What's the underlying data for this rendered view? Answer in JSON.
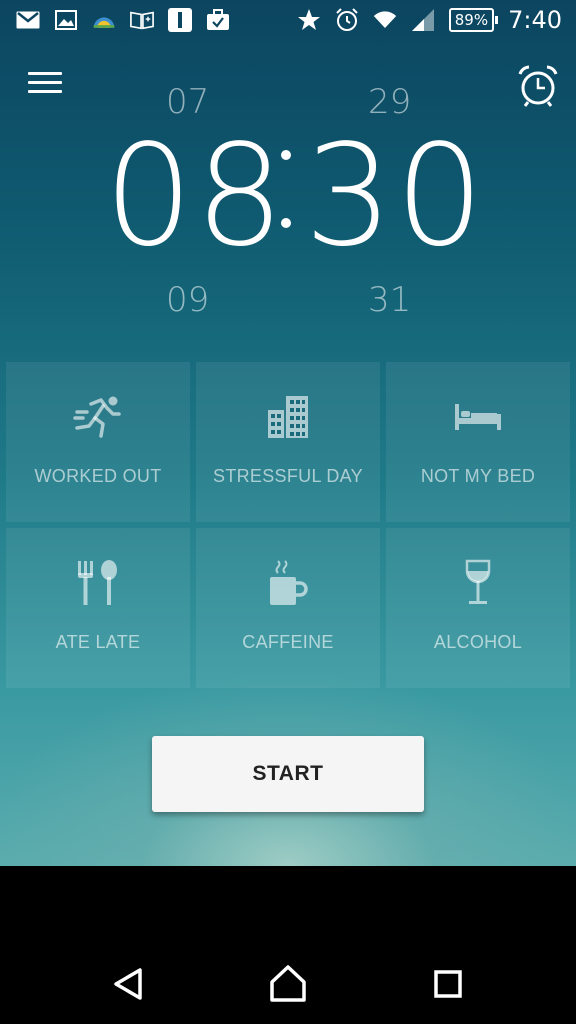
{
  "status_bar": {
    "battery": "89%",
    "time": "7:40"
  },
  "clock": {
    "hour_prev": "07",
    "minute_prev": "29",
    "hour": "08",
    "minute": "30",
    "hour_next": "09",
    "minute_next": "31"
  },
  "factors": [
    {
      "label": "WORKED OUT",
      "icon": "running-person-icon"
    },
    {
      "label": "STRESSFUL DAY",
      "icon": "office-building-icon"
    },
    {
      "label": "NOT MY BED",
      "icon": "bed-icon"
    },
    {
      "label": "ATE LATE",
      "icon": "fork-spoon-icon"
    },
    {
      "label": "CAFFEINE",
      "icon": "coffee-cup-icon"
    },
    {
      "label": "ALCOHOL",
      "icon": "wine-glass-icon"
    }
  ],
  "start_label": "START",
  "colors": {
    "accent": "#ffffff",
    "background_top": "#0c4560",
    "background_bottom": "#59acad"
  }
}
